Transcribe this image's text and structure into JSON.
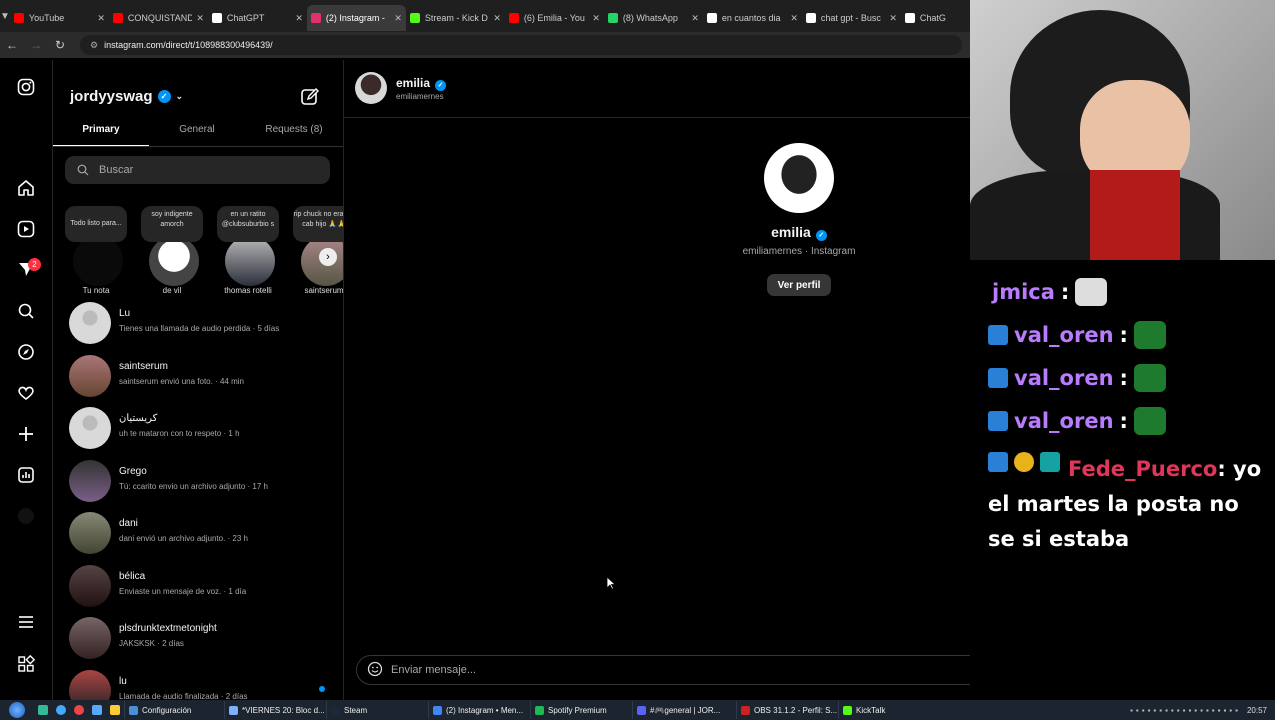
{
  "browser": {
    "tabs": [
      {
        "label": "YouTube",
        "color": "#ff0000"
      },
      {
        "label": "CONQUISTANDO",
        "color": "#ff0000"
      },
      {
        "label": "ChatGPT",
        "color": "#ffffff"
      },
      {
        "label": "(2) Instagram -",
        "color": "#e1306c",
        "active": true
      },
      {
        "label": "Stream - Kick D",
        "color": "#53fc18"
      },
      {
        "label": "(6) Emilia - You",
        "color": "#ff0000"
      },
      {
        "label": "(8) WhatsApp",
        "color": "#25d366"
      },
      {
        "label": "en cuantos dia",
        "color": "#ffffff"
      },
      {
        "label": "chat gpt - Busc",
        "color": "#ffffff"
      },
      {
        "label": "ChatG",
        "color": "#ffffff"
      }
    ],
    "url": "instagram.com/direct/t/108988300496439/"
  },
  "rail": {
    "notifications_badge": "2"
  },
  "inbox": {
    "username": "jordyyswag",
    "tabs": [
      "Primary",
      "General",
      "Requests (8)"
    ],
    "search_placeholder": "Buscar",
    "notes": [
      {
        "bubble": "Todo listo para...",
        "name": "Tu nota"
      },
      {
        "bubble": "soy indigente amorch",
        "name": "de vil"
      },
      {
        "bubble": "en un ratito @clubsuburbio s",
        "name": "thomas rotelli"
      },
      {
        "bubble": "rip chuck no eras la cab hijo 🙏🙏",
        "name": "saintserum"
      }
    ],
    "conversations": [
      {
        "name": "Lu",
        "preview": "Tienes una llamada de audio perdida · 5 días"
      },
      {
        "name": "saintserum",
        "preview": "saintserum envió una foto. · 44 min"
      },
      {
        "name": "كريستيان",
        "preview": "uh te mataron con to respeto · 1 h"
      },
      {
        "name": "Grego",
        "preview": "Tú: ccarito envio un archivo adjunto · 17 h"
      },
      {
        "name": "dani",
        "preview": "dani envió un archivo adjunto. · 23 h"
      },
      {
        "name": "bélica",
        "preview": "Enviaste un mensaje de voz. · 1 día"
      },
      {
        "name": "plsdrunktextmetonight",
        "preview": "JAKSKSK · 2 días"
      },
      {
        "name": "lu",
        "preview": "Llamada de audio finalizada · 2 días"
      }
    ]
  },
  "chat": {
    "header_name": "emilia",
    "header_handle": "emiliamernes",
    "profile_name": "emilia",
    "profile_sub": "emiliamernes · Instagram",
    "view_profile": "Ver perfil",
    "message_placeholder": "Enviar mensaje..."
  },
  "stream_chat": {
    "lines": [
      {
        "user": "jmica",
        "sep": ":",
        "color": "#b97cff"
      },
      {
        "user": "val_oren",
        "sep": ":",
        "color": "#b97cff"
      },
      {
        "user": "val_oren",
        "sep": ":",
        "color": "#b97cff"
      },
      {
        "user": "val_oren",
        "sep": ":",
        "color": "#b97cff"
      }
    ],
    "last_user": "Fede_Puerco",
    "last_user_color": "#e0365a",
    "last_message": ": yo el martes la posta no se si estaba"
  },
  "taskbar": {
    "items": [
      "Configuración",
      "*VIERNES 20: Bloc d...",
      "Steam",
      "(2) Instagram • Men...",
      "Spotify Premium",
      "#🎮general | JOR...",
      "OBS 31.1.2 - Perfil: S...",
      "KickTalk"
    ],
    "clock": "20:57"
  }
}
